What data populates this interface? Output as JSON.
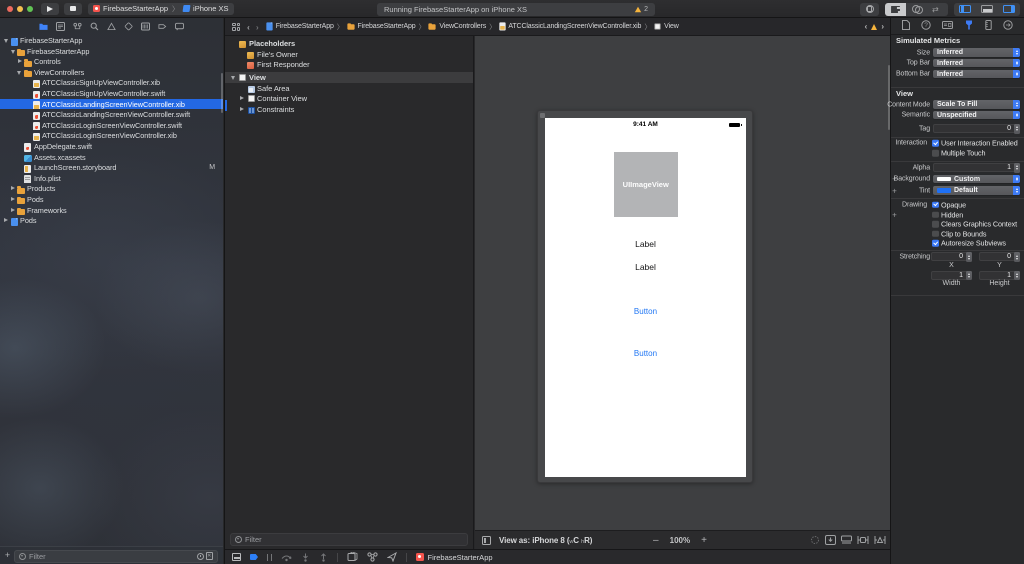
{
  "icons": {
    "chevron_right": "〉",
    "back_chevron": "‹",
    "forward_chevron": "›",
    "swap_arrows": "⇄",
    "plus": "+",
    "question_mark": "?"
  },
  "colors": {
    "accent_blue": "#3e7bf5",
    "selection_blue": "#2368e4",
    "warning_yellow": "#f6b43c",
    "app_red": "#f5544d",
    "canvas_gray": "#3e3f41",
    "button_blue": "#2177f4"
  },
  "toolbar": {
    "scheme": "FirebaseStarterApp",
    "destination": "iPhone XS",
    "status": "Running FirebaseStarterApp on iPhone XS",
    "warning_count": "2"
  },
  "navigator": {
    "rows": [
      {
        "label": "FirebaseStarterApp"
      },
      {
        "label": "FirebaseStarterApp"
      },
      {
        "label": "Controls"
      },
      {
        "label": "ViewControllers"
      },
      {
        "label": "ATCClassicSignUpViewController.xib"
      },
      {
        "label": "ATCClassicSignUpViewController.swift"
      },
      {
        "label": "ATCClassicLandingScreenViewController.xib"
      },
      {
        "label": "ATCClassicLandingScreenViewController.swift"
      },
      {
        "label": "ATCClassicLoginScreenViewController.swift"
      },
      {
        "label": "ATCClassicLoginScreenViewController.xib"
      },
      {
        "label": "AppDelegate.swift"
      },
      {
        "label": "Assets.xcassets"
      },
      {
        "label": "LaunchScreen.storyboard",
        "badge": "M"
      },
      {
        "label": "Info.plist"
      },
      {
        "label": "Products"
      },
      {
        "label": "Pods"
      },
      {
        "label": "Frameworks"
      },
      {
        "label": "Pods"
      }
    ],
    "filter_placeholder": "Filter"
  },
  "jumpbar": {
    "crumbs": [
      "FirebaseStarterApp",
      "FirebaseStarterApp",
      "ViewControllers",
      "ATCClassicLandingScreenViewController.xib",
      "View"
    ]
  },
  "outline": {
    "rows": [
      {
        "label": "Placeholders"
      },
      {
        "label": "File's Owner"
      },
      {
        "label": "First Responder"
      },
      {
        "label": "View"
      },
      {
        "label": "Safe Area"
      },
      {
        "label": "Container View"
      },
      {
        "label": "Constraints"
      }
    ],
    "filter_placeholder": "Filter"
  },
  "canvas": {
    "device": {
      "time": "9:41 AM",
      "imageview_label": "UIImageView",
      "label1": "Label",
      "label2": "Label",
      "button1": "Button",
      "button2": "Button"
    },
    "viewas": {
      "prefix": "View as: iPhone 8 (",
      "w": "w",
      "c": "C ",
      "h": "h",
      "r": "R",
      "suffix": ")",
      "minus": "–",
      "zoom": "100%",
      "plus": "+"
    }
  },
  "debugbar": {
    "process": "FirebaseStarterApp"
  },
  "inspector": {
    "headers": {
      "simulated_metrics": "Simulated Metrics",
      "view": "View"
    },
    "size": {
      "label": "Size",
      "value": "Inferred"
    },
    "top_bar": {
      "label": "Top Bar",
      "value": "Inferred"
    },
    "bottom_bar": {
      "label": "Bottom Bar",
      "value": "Inferred"
    },
    "content_mode": {
      "label": "Content Mode",
      "value": "Scale To Fill"
    },
    "semantic": {
      "label": "Semantic",
      "value": "Unspecified"
    },
    "tag": {
      "label": "Tag",
      "value": "0"
    },
    "interaction": {
      "label": "Interaction",
      "cb1": "User Interaction Enabled",
      "cb2": "Multiple Touch"
    },
    "alpha": {
      "label": "Alpha",
      "value": "1"
    },
    "background": {
      "label": "Background",
      "value": "Custom"
    },
    "tint": {
      "label": "Tint",
      "value": "Default"
    },
    "drawing": {
      "label": "Drawing",
      "cb1": "Opaque",
      "cb2": "Hidden",
      "cb3": "Clears Graphics Context",
      "cb4": "Clip to Bounds",
      "cb5": "Autoresize Subviews"
    },
    "stretching": {
      "label": "Stretching",
      "x_value": "0",
      "y_value": "0",
      "x_label": "X",
      "y_label": "Y",
      "w_value": "1",
      "h_value": "1",
      "w_label": "Width",
      "h_label": "Height"
    }
  }
}
